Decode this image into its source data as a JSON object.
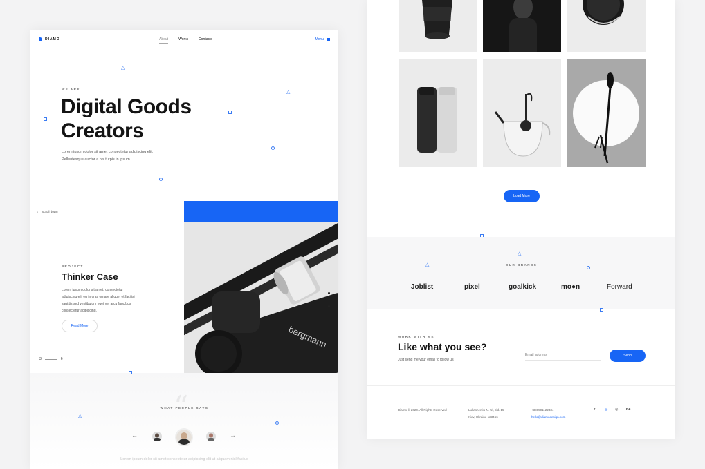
{
  "header": {
    "logo": "DIAMO",
    "nav": [
      "About",
      "Works",
      "Contacts"
    ],
    "menu": "Menu"
  },
  "hero": {
    "eyebrow": "WE ARE",
    "title_line1": "Digital Goods",
    "title_line2": "Creators",
    "text_line1": "Lorem ipsum dolor sit amet consectetur adipiscing elit.",
    "text_line2": "Pellentesque auctor a nis turpis in ipsum."
  },
  "scroll_down": "Scroll down",
  "project": {
    "eyebrow": "PROJECT",
    "title": "Thinker Case",
    "text": "Lorem ipsum dolor sit amet, consectetur adipiscing elit eu in cras ornare aliquet et facilisi sagittis sed vestibulum eget vel arcu faucibus consectetur adipiscing.",
    "button": "Read More",
    "image_text": "bergmann",
    "pager_current": "3",
    "pager_total": "6"
  },
  "testimonials": {
    "quote": "“",
    "eyebrow": "WHAT PEOPLE SAYS",
    "prev": "←",
    "next": "→",
    "text": "Lorem ipsum dolor sit amet consectetur adipiscing elit ut aliquam nisl facilus"
  },
  "gallery": {
    "load_more": "Load More"
  },
  "brands": {
    "eyebrow": "OUR BRANDS",
    "items": [
      "Joblist",
      "pixel",
      "goalkick",
      "mo●n",
      "Forward"
    ]
  },
  "work": {
    "eyebrow": "WORK WITH ME",
    "title": "Like what you see?",
    "text": "Just send me your email to follow us",
    "email_placeholder": "Email address",
    "send": "Send"
  },
  "footer": {
    "copyright": "Diamo © 2020. All Rights Reserved",
    "address_line1": "Lukashenko N. Ui, bld. 15",
    "address_line2": "Kiev, Ukraine 123456",
    "phone": "+380501122334",
    "email": "hello@diamodesign.com",
    "social": [
      "f",
      "◎",
      "◎",
      "Bē"
    ]
  },
  "colors": {
    "accent": "#1765f5",
    "dark": "#141414",
    "light_bg": "#f7f7f8"
  }
}
